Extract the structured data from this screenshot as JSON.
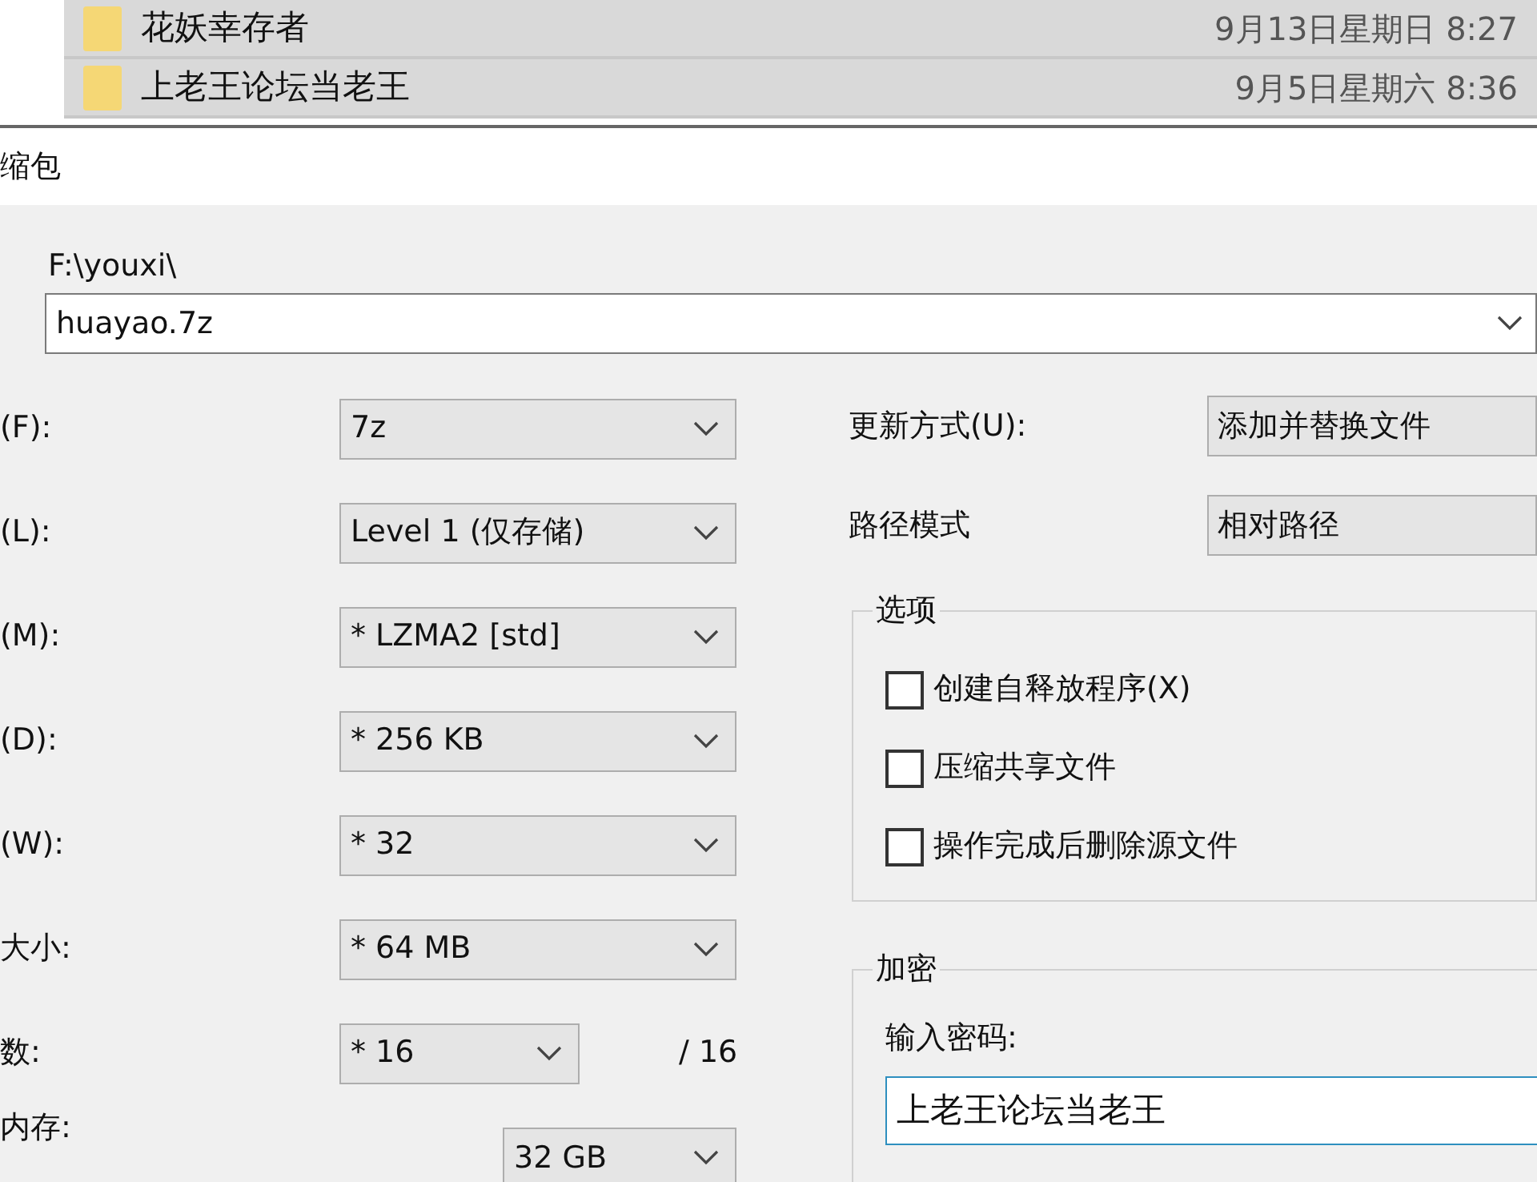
{
  "file_list": [
    {
      "name": "花妖幸存者",
      "date": "9月13日星期日 8:27",
      "selected": true
    },
    {
      "name": "上老王论坛当老王",
      "date": "9月5日星期六 8:36",
      "selected": true
    }
  ],
  "dialog": {
    "title": "缩包",
    "path": "F:\\youxi\\",
    "archive_name": "huayao.7z",
    "settings": [
      {
        "label": "(F):",
        "value": "7z",
        "kind": "full"
      },
      {
        "label": "(L):",
        "value": "Level 1 (仅存储)",
        "kind": "full"
      },
      {
        "label": "(M):",
        "value": "* LZMA2 [std]",
        "kind": "full"
      },
      {
        "label": "(D):",
        "value": "* 256 KB",
        "kind": "full"
      },
      {
        "label": "(W):",
        "value": "* 32",
        "kind": "full"
      },
      {
        "label": "大小:",
        "value": "* 64 MB",
        "kind": "full"
      },
      {
        "label": "数:",
        "value": "* 16",
        "kind": "short",
        "suffix": "/ 16"
      },
      {
        "label": "内存:",
        "value": "32 GB",
        "kind": "offset"
      }
    ],
    "update_mode": {
      "label": "更新方式(U):",
      "value": "添加并替换文件"
    },
    "path_mode": {
      "label": "路径模式",
      "value": "相对路径"
    },
    "options": {
      "title": "选项",
      "items": [
        {
          "label": "创建自释放程序(X)",
          "checked": false
        },
        {
          "label": "压缩共享文件",
          "checked": false
        },
        {
          "label": "操作完成后删除源文件",
          "checked": false
        }
      ]
    },
    "encryption": {
      "title": "加密",
      "password_label": "输入密码:",
      "password": "上老王论坛当老王"
    }
  }
}
